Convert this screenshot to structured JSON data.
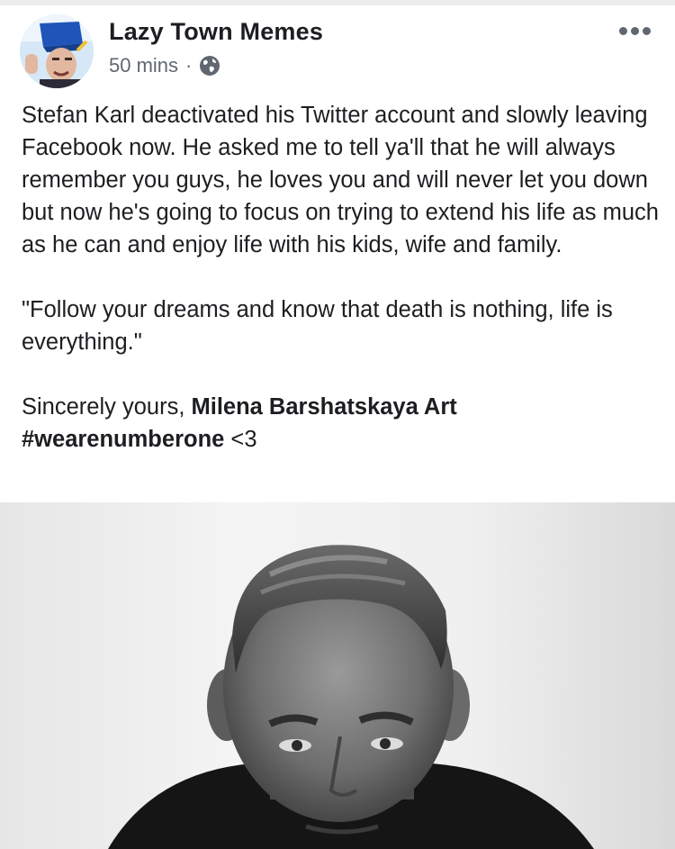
{
  "post": {
    "author": "Lazy Town Memes",
    "time": "50 mins",
    "separator": "·",
    "privacy_icon": "globe-icon",
    "menu_icon": "more-options-icon",
    "paragraphs": {
      "p1": "Stefan Karl deactivated his Twitter account and slowly leaving Facebook now. He asked me to tell ya'll that he will always remember you guys, he loves you and will never let you down but now he's going to focus on trying to extend his life as much as he can and enjoy life with his kids, wife and family.",
      "p2": "\"Follow your dreams and know that death is nothing, life is everything.\"",
      "sign_prefix": "Sincerely yours, ",
      "sign_name": "Milena Barshatskaya Art",
      "hashtag": "#wearenumberone",
      "heart": " <3"
    }
  },
  "colors": {
    "text": "#1c1e21",
    "secondary": "#606770"
  }
}
